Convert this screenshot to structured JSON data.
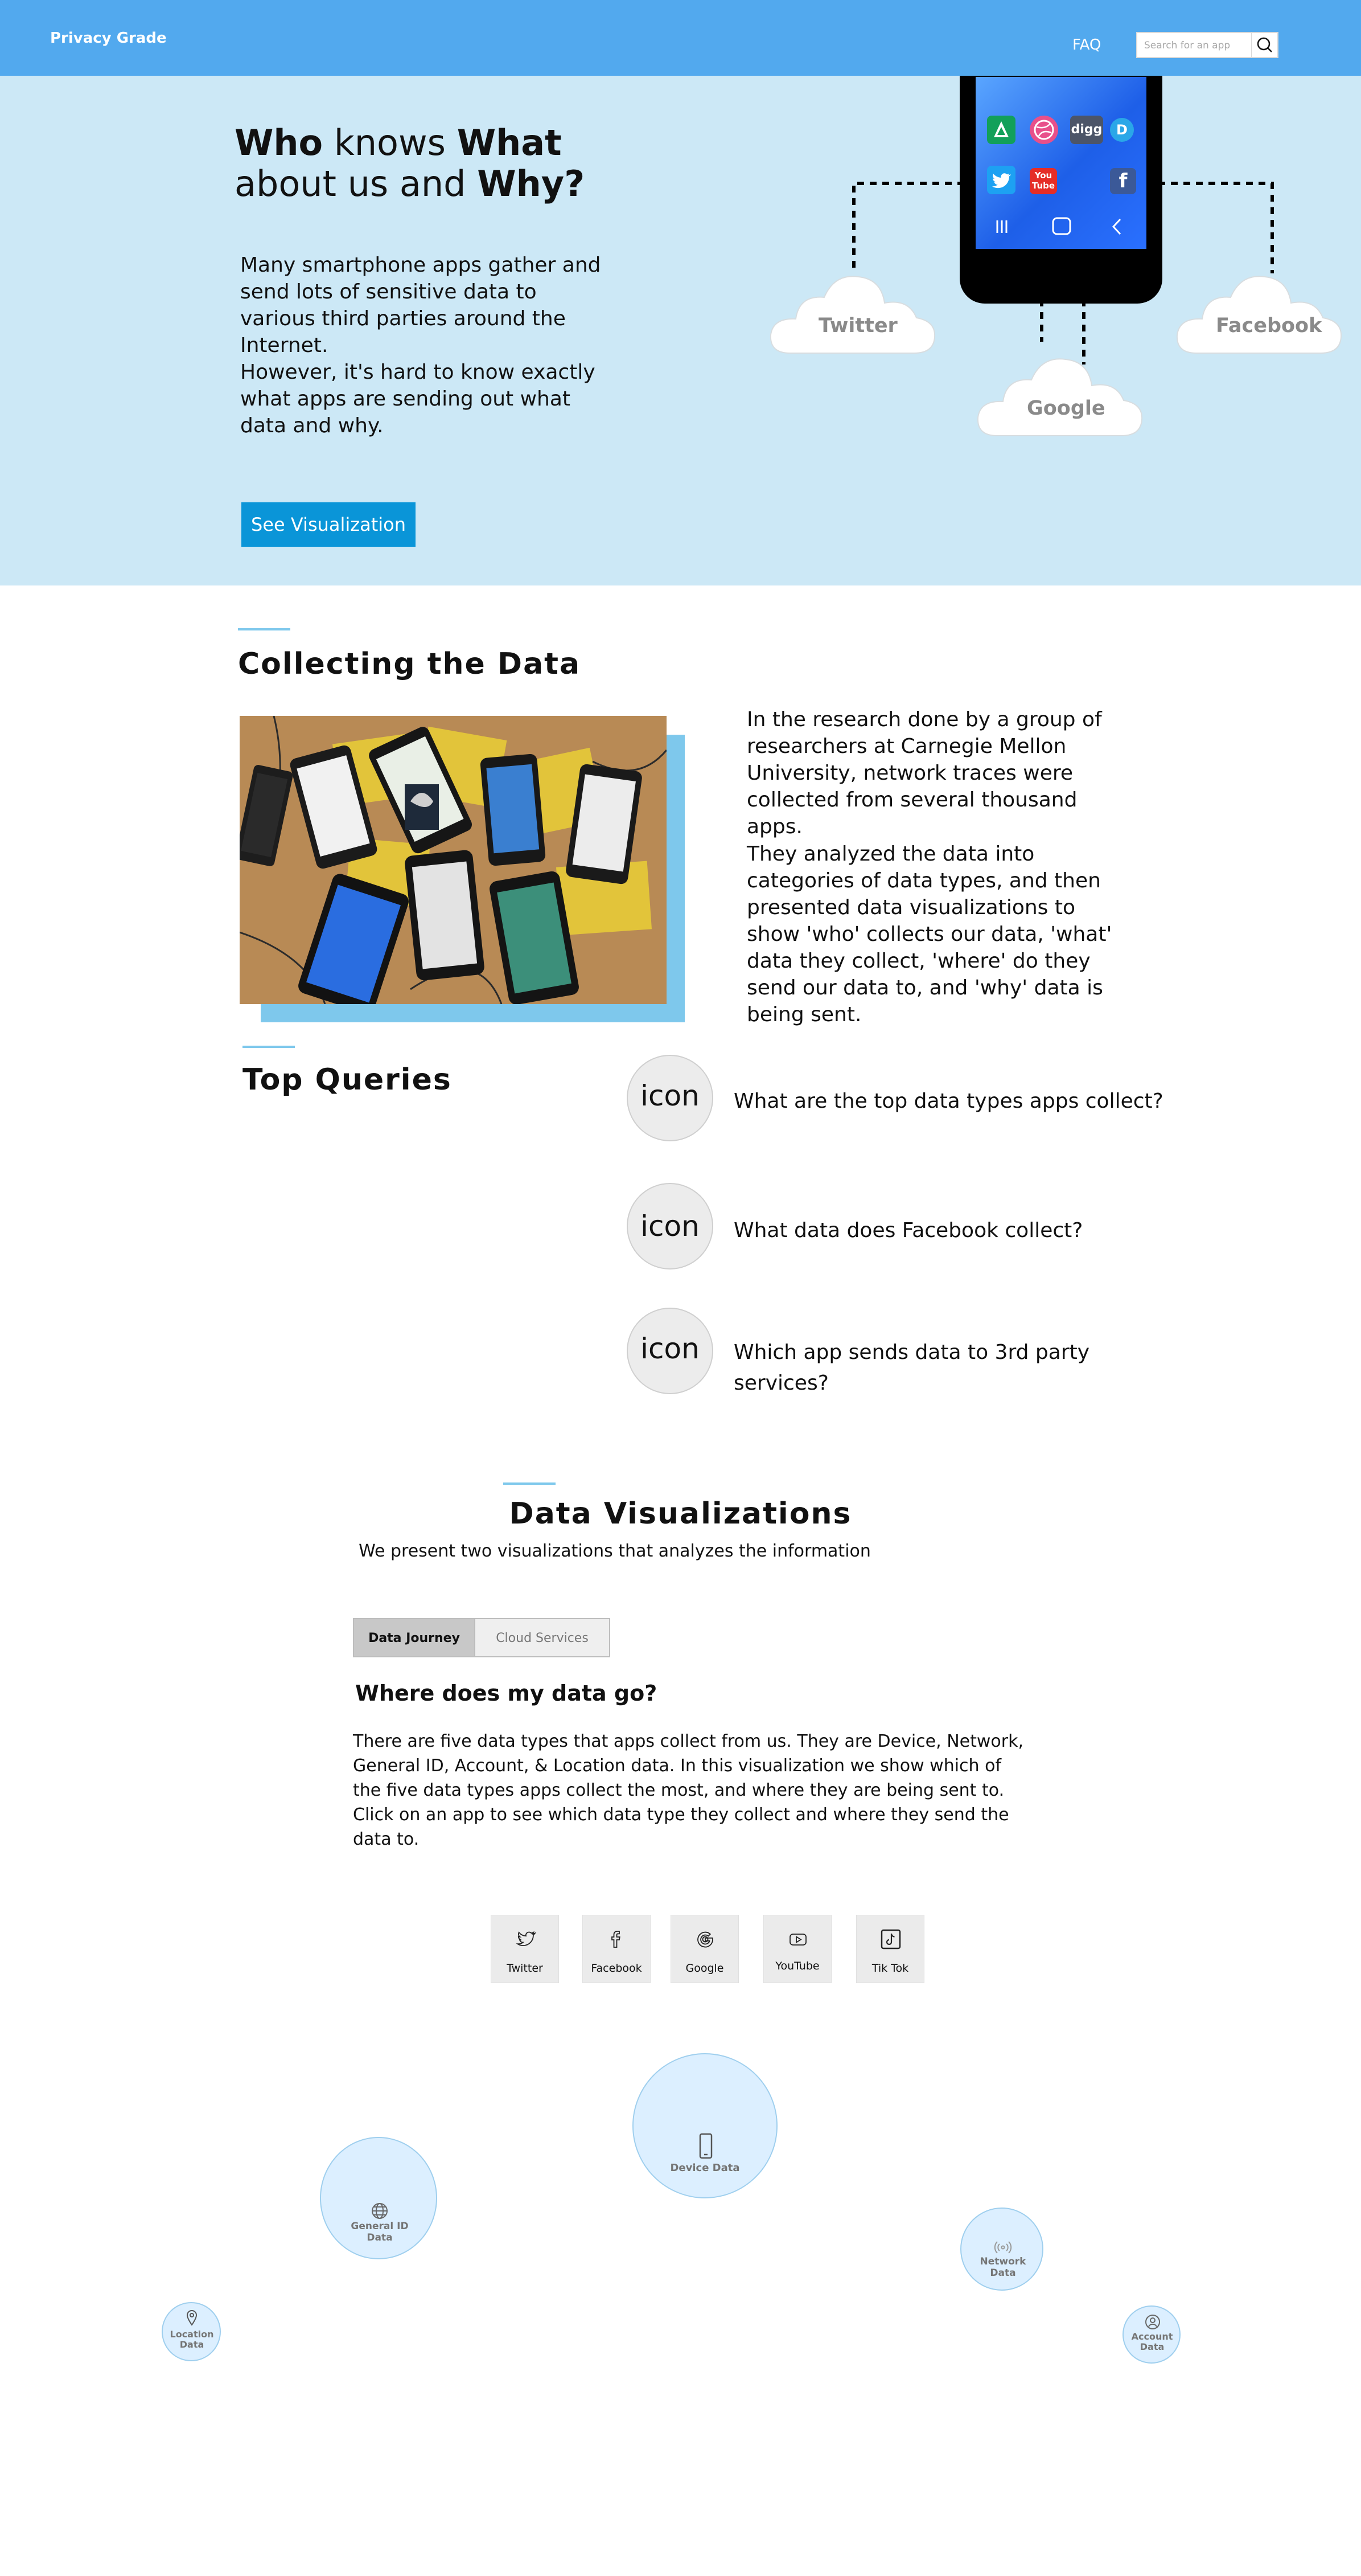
{
  "header": {
    "brand": "Privacy Grade",
    "faq": "FAQ",
    "search_placeholder": "Search for an app"
  },
  "hero": {
    "title_w1": "Who",
    "title_w2": " knows ",
    "title_w3": "What",
    "title_w4": "about us and ",
    "title_w5": "Why?",
    "para1": "Many smartphone apps gather and send lots of sensitive data to various third parties around the Internet.",
    "para2": "However, it's hard to know exactly what apps are sending out what data and why.",
    "cta": "See Visualization",
    "phone_icons": [
      "digg",
      "D",
      "You Tube"
    ],
    "clouds": [
      "Twitter",
      "Google",
      "Facebook"
    ]
  },
  "collecting": {
    "heading": "Collecting the Data",
    "para1": "In the research done by a group of researchers at Carnegie Mellon University, network traces were collected from several thousand apps.",
    "para2": "They analyzed the data into categories of data types, and then presented data visualizations to show 'who' collects our data, 'what' data they collect, 'where' do they send our data to, and 'why' data is being sent."
  },
  "top_queries": {
    "heading": "Top Queries",
    "items": [
      {
        "icon": "icon",
        "text": "What are the top data types apps collect?"
      },
      {
        "icon": "icon",
        "text": "What data does Facebook collect?"
      },
      {
        "icon": "icon",
        "text": "Which app sends data to 3rd party services?"
      }
    ]
  },
  "data_viz": {
    "heading": "Data Visualizations",
    "subtitle": "We present two visualizations that analyzes the information",
    "tabs": [
      "Data Journey",
      "Cloud Services"
    ],
    "active_tab": "Data Journey",
    "section_title": "Where does my data go?",
    "description": "There are five data types that apps collect from us. They are Device, Network, General ID, Account, & Location data. In this visualization we show which of the five data types apps collect the most, and where they are being sent to. Click on an app to see which data type they collect and where they send the data to.",
    "apps": [
      {
        "label": "Twitter",
        "icon": "twitter-icon"
      },
      {
        "label": "Facebook",
        "icon": "facebook-icon"
      },
      {
        "label": "Google",
        "icon": "google-icon"
      },
      {
        "label": "YouTube",
        "icon": "youtube-icon"
      },
      {
        "label": "Tik Tok",
        "icon": "tiktok-icon"
      }
    ],
    "data_types": [
      {
        "label": "Device Data",
        "icon": "smartphone-icon"
      },
      {
        "label": "General ID Data",
        "icon": "globe-icon"
      },
      {
        "label": "Network Data",
        "icon": "broadcast-icon"
      },
      {
        "label": "Location Data",
        "icon": "location-pin-icon"
      },
      {
        "label": "Account Data",
        "icon": "account-icon"
      }
    ]
  },
  "colors": {
    "header": "#52a9ee",
    "hero_bg": "#cce8f6",
    "cta": "#0a95d8",
    "accent": "#7ec8ec",
    "bubble_fill": "#dcefff"
  }
}
